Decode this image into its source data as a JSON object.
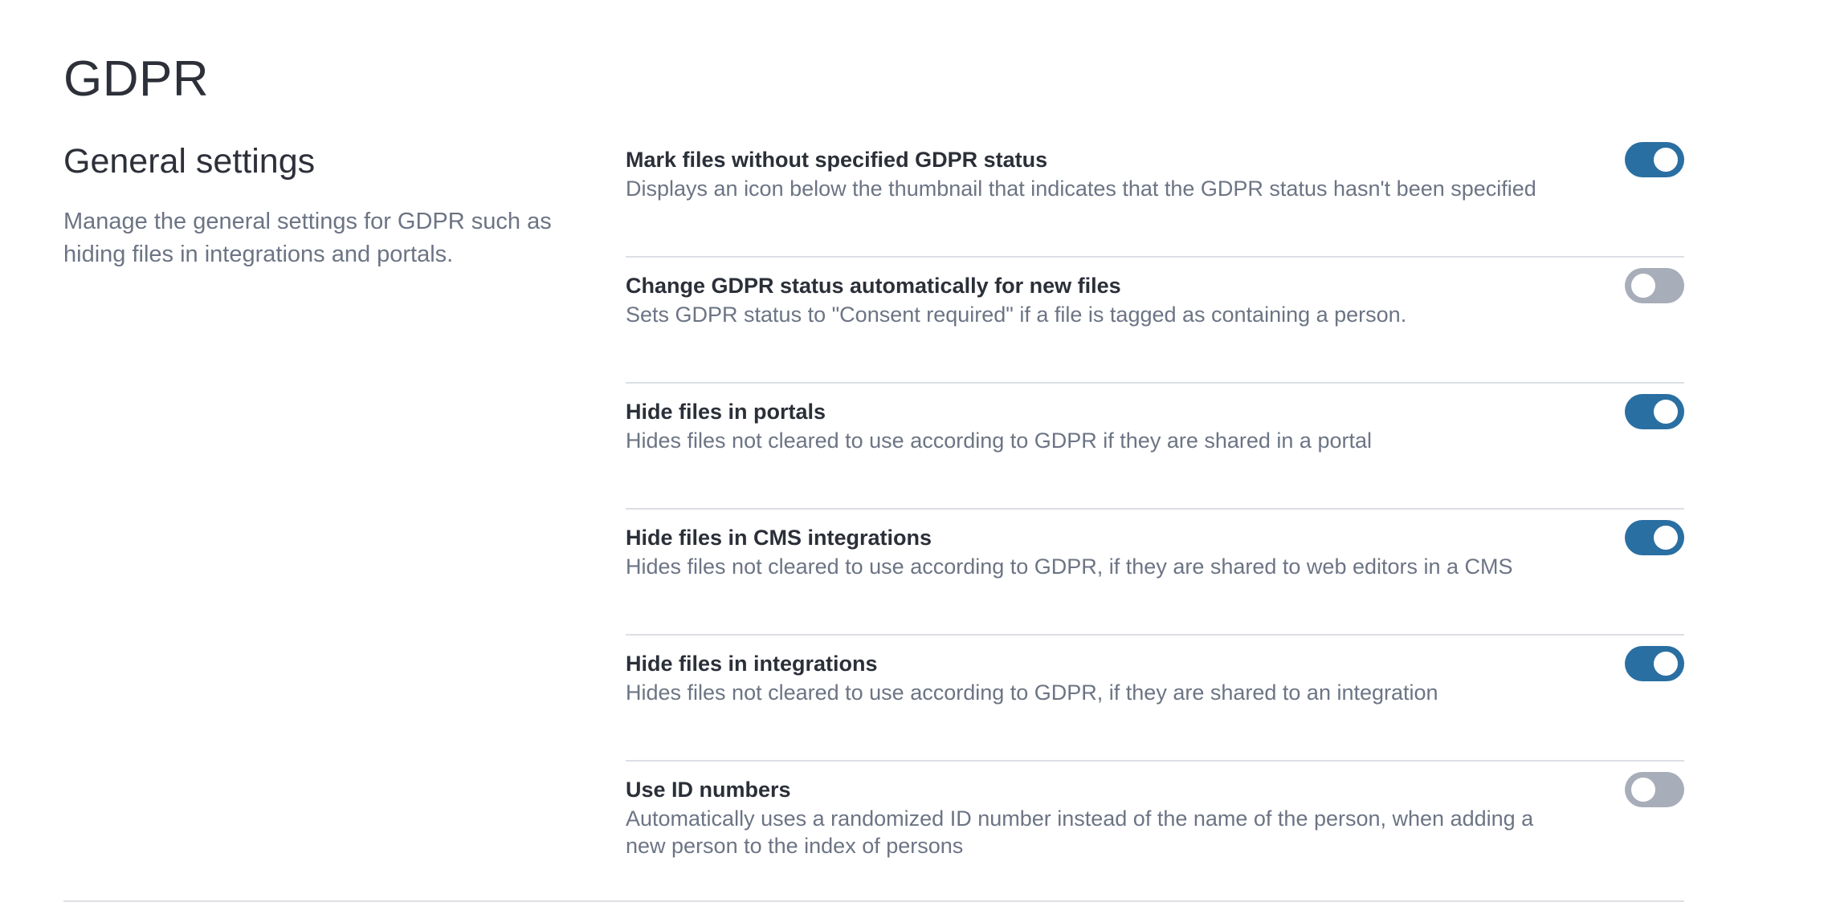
{
  "page": {
    "title": "GDPR"
  },
  "general": {
    "title": "General settings",
    "description": "Manage the general settings for GDPR such as hiding files in integrations and portals."
  },
  "settings": [
    {
      "label": "Mark files without specified GDPR status",
      "description": "Displays an icon below the thumbnail that indicates that the GDPR status hasn't been specified",
      "enabled": true
    },
    {
      "label": "Change GDPR status automatically for new files",
      "description": "Sets GDPR status to \"Consent required\" if a file is tagged as containing a person.",
      "enabled": false
    },
    {
      "label": "Hide files in portals",
      "description": "Hides files not cleared to use according to GDPR if they are shared in a portal",
      "enabled": true
    },
    {
      "label": "Hide files in CMS integrations",
      "description": "Hides files not cleared to use according to GDPR, if they are shared to web editors in a CMS",
      "enabled": true
    },
    {
      "label": "Hide files in integrations",
      "description": "Hides files not cleared to use according to GDPR, if they are shared to an integration",
      "enabled": true
    },
    {
      "label": "Use ID numbers",
      "description": "Automatically uses a randomized ID number instead of the name of the person, when adding a new person to the index of persons",
      "enabled": false
    }
  ],
  "colors": {
    "toggle_on": "#2a6fa2",
    "toggle_off": "#a7adb9",
    "text_primary": "#2b2f38",
    "text_secondary": "#6c7484",
    "divider": "#dcdfe4"
  }
}
